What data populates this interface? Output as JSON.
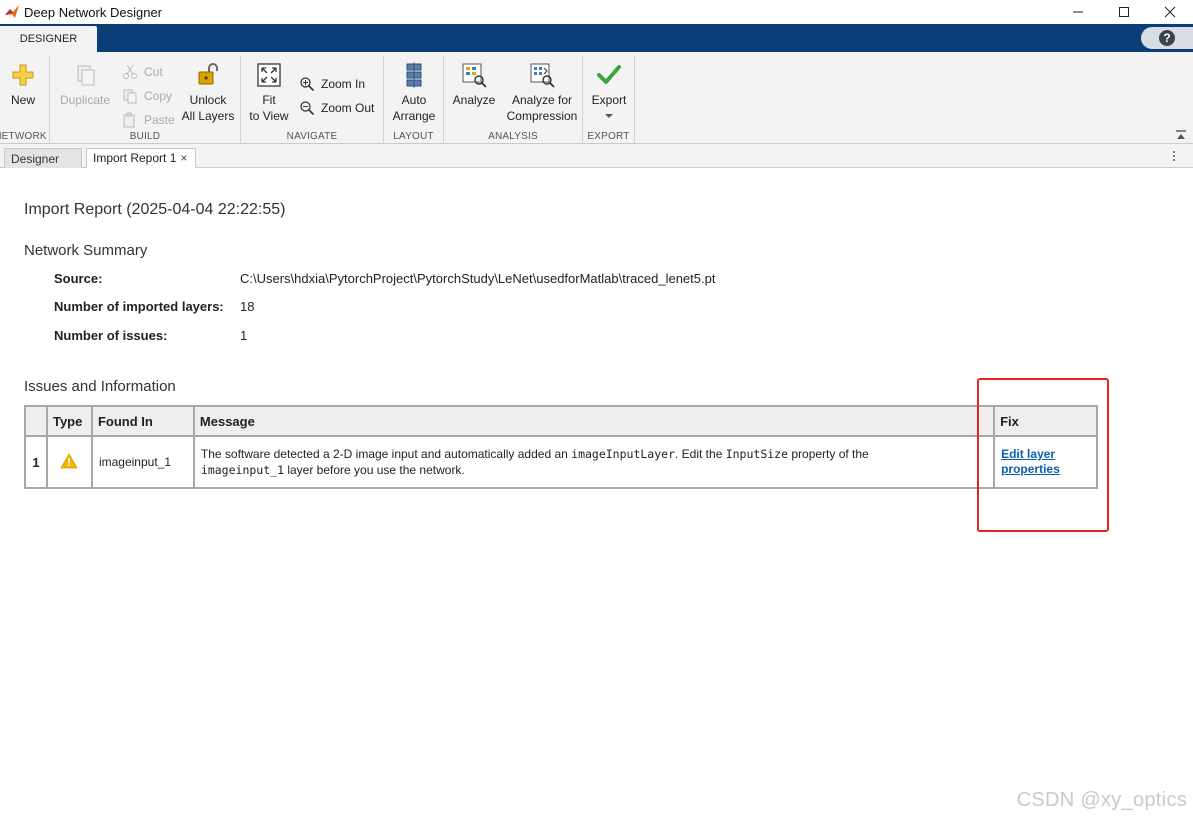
{
  "window": {
    "title": "Deep Network Designer"
  },
  "ribbon": {
    "tab": "DESIGNER",
    "help_label": "?",
    "groups": {
      "network": {
        "label": "NETWORK",
        "new_label": "New"
      },
      "build": {
        "label": "BUILD",
        "duplicate_label": "Duplicate",
        "cut_label": "Cut",
        "copy_label": "Copy",
        "paste_label": "Paste",
        "unlock_label_1": "Unlock",
        "unlock_label_2": "All Layers"
      },
      "navigate": {
        "label": "NAVIGATE",
        "fit_label_1": "Fit",
        "fit_label_2": "to View",
        "zoom_in_label": "Zoom In",
        "zoom_out_label": "Zoom Out"
      },
      "layout": {
        "label": "LAYOUT",
        "auto_label_1": "Auto",
        "auto_label_2": "Arrange"
      },
      "analysis": {
        "label": "ANALYSIS",
        "analyze_label": "Analyze",
        "compress_label_1": "Analyze for",
        "compress_label_2": "Compression"
      },
      "export": {
        "label": "EXPORT",
        "export_label": "Export"
      }
    }
  },
  "doc_tabs": {
    "designer": "Designer",
    "import_report": "Import Report 1",
    "close": "×"
  },
  "report": {
    "title": "Import Report (2025-04-04 22:22:55)",
    "summary_heading": "Network Summary",
    "source_label": "Source:",
    "source_value": "C:\\Users\\hdxia\\PytorchProject\\PytorchStudy\\LeNet\\usedforMatlab\\traced_lenet5.pt",
    "layers_label": "Number of imported layers:",
    "layers_value": "18",
    "issues_label": "Number of issues:",
    "issues_value": "1",
    "issues_heading": "Issues and Information",
    "table": {
      "headers": {
        "num": "",
        "type": "Type",
        "found_in": "Found In",
        "message": "Message",
        "fix": "Fix"
      },
      "rows": [
        {
          "num": "1",
          "type_icon": "warning-icon",
          "found_in": "imageinput_1",
          "msg_part1": "The software detected a 2-D image input and automatically added an ",
          "msg_code1": "imageInputLayer",
          "msg_part2": ". Edit the ",
          "msg_code2": "InputSize",
          "msg_part3": " property of the",
          "msg_code3": "imageinput_1",
          "msg_part4": " layer before you use the network.",
          "fix_line1": "Edit layer",
          "fix_line2": "properties"
        }
      ]
    }
  },
  "watermark": "CSDN @xy_optics",
  "colors": {
    "tab_strip": "#0b3e76",
    "toolstrip": "#f3f3f3",
    "link": "#0b5fb0",
    "highlight": "#e8231f",
    "warning": "#f2b600"
  }
}
